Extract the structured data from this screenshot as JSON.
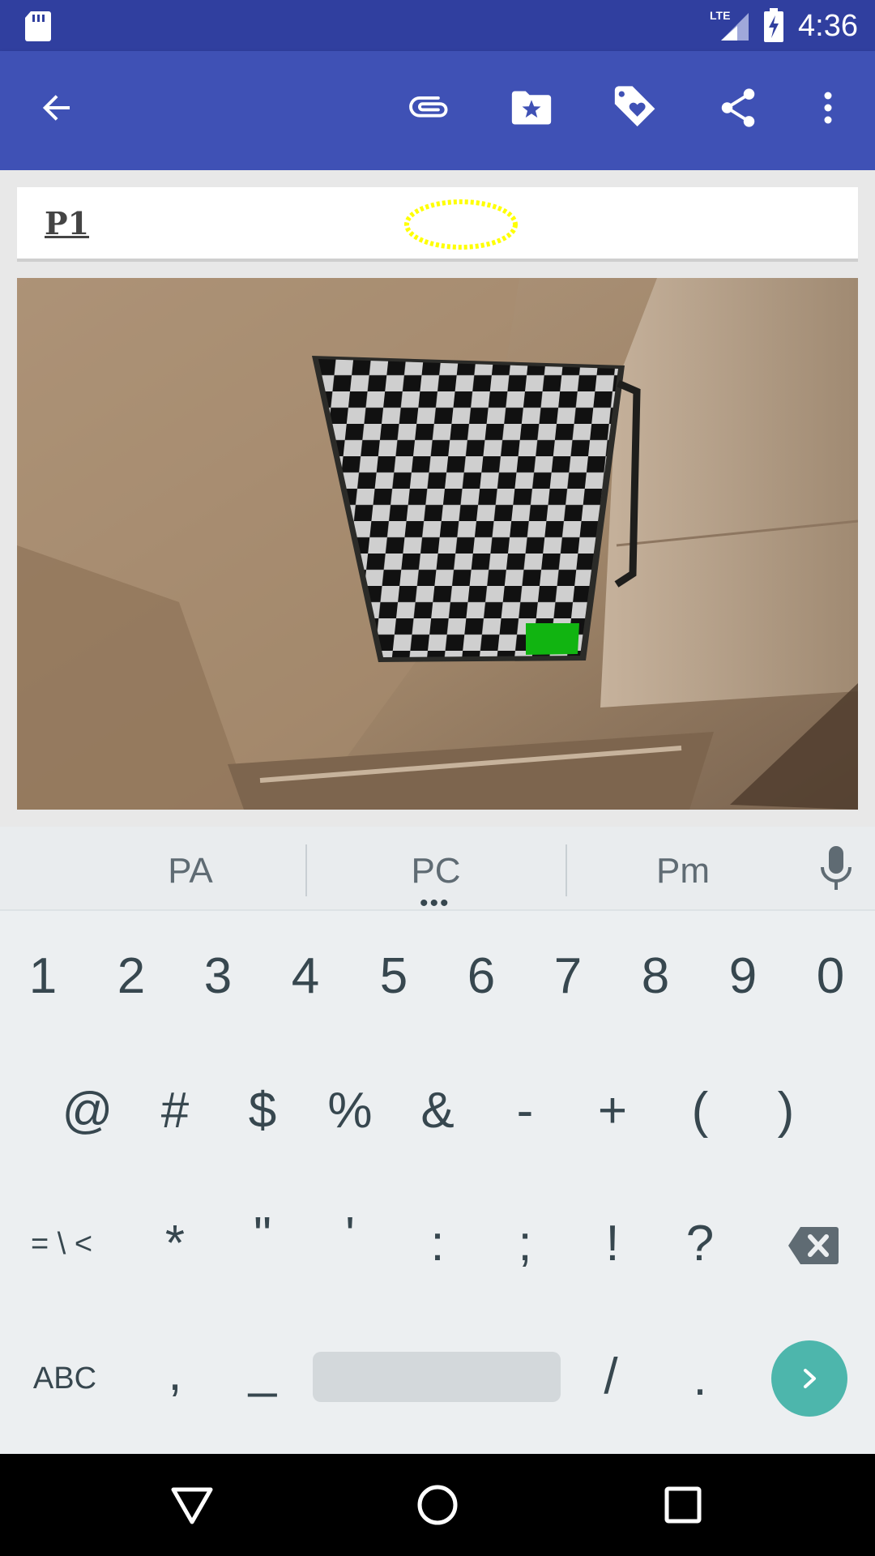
{
  "status_bar": {
    "time": "4:36",
    "network": "LTE",
    "icons": [
      "sd-card-icon",
      "lte-signal-icon",
      "battery-charging-icon"
    ]
  },
  "app_bar": {
    "actions": [
      "back-arrow-icon",
      "attach-icon",
      "star-folder-icon",
      "tag-heart-icon",
      "share-icon",
      "more-vert-icon"
    ]
  },
  "field": {
    "text": "P1",
    "annotation_color": "#ffff00"
  },
  "photo": {
    "subject": "checkerboard",
    "highlight_color": "#11b411"
  },
  "keyboard": {
    "suggestions": [
      "PA",
      "PC",
      "Pm"
    ],
    "row1": [
      "1",
      "2",
      "3",
      "4",
      "5",
      "6",
      "7",
      "8",
      "9",
      "0"
    ],
    "row2": [
      "@",
      "#",
      "$",
      "%",
      "&",
      "-",
      "+",
      "(",
      ")"
    ],
    "row3": [
      "= \\ <",
      "*",
      "\"",
      "'",
      ":",
      ";",
      "!",
      "?"
    ],
    "row4": [
      "ABC",
      ",",
      "_",
      "/",
      "."
    ],
    "accent": "#4db6ac"
  },
  "colors": {
    "status_bar": "#303f9f",
    "app_bar": "#3f51b5"
  }
}
